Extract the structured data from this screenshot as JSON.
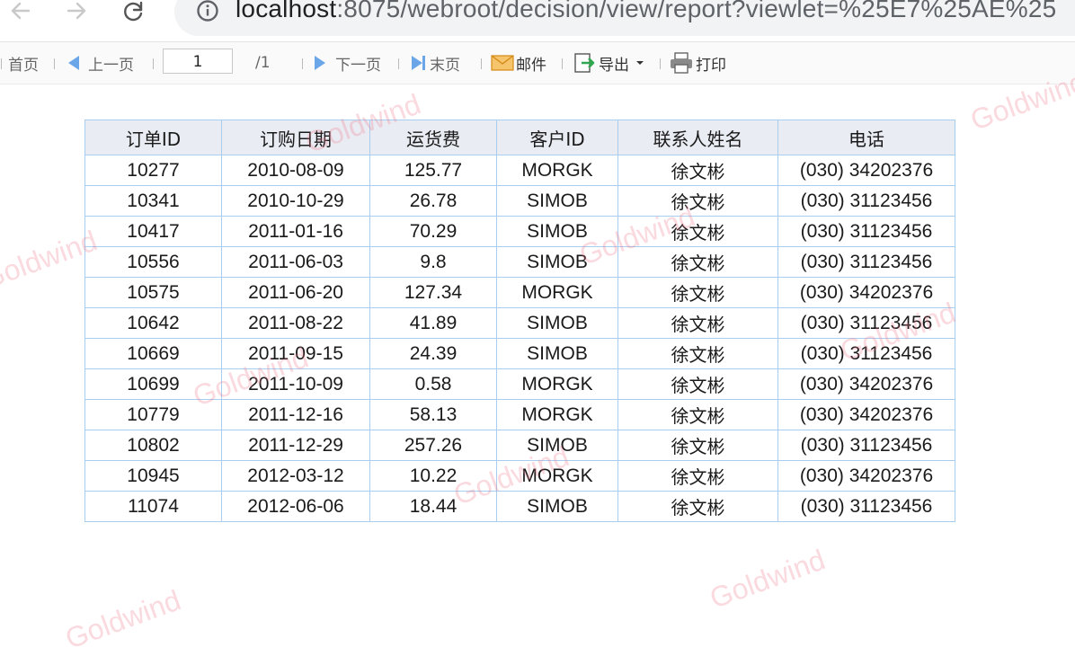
{
  "browser": {
    "url_host": "localhost",
    "url_rest": ":8075/webroot/decision/view/report?viewlet=%25E7%25AE%25"
  },
  "toolbar": {
    "first": "首页",
    "prev": "上一页",
    "page_current": "1",
    "page_total": "/1",
    "next": "下一页",
    "last": "末页",
    "mail": "邮件",
    "export": "导出",
    "print": "打印"
  },
  "table": {
    "headers": [
      "订单ID",
      "订购日期",
      "运货费",
      "客户ID",
      "联系人姓名",
      "电话"
    ],
    "rows": [
      [
        "10277",
        "2010-08-09",
        "125.77",
        "MORGK",
        "徐文彬",
        "(030) 34202376"
      ],
      [
        "10341",
        "2010-10-29",
        "26.78",
        "SIMOB",
        "徐文彬",
        "(030) 31123456"
      ],
      [
        "10417",
        "2011-01-16",
        "70.29",
        "SIMOB",
        "徐文彬",
        "(030) 31123456"
      ],
      [
        "10556",
        "2011-06-03",
        "9.8",
        "SIMOB",
        "徐文彬",
        "(030) 31123456"
      ],
      [
        "10575",
        "2011-06-20",
        "127.34",
        "MORGK",
        "徐文彬",
        "(030) 34202376"
      ],
      [
        "10642",
        "2011-08-22",
        "41.89",
        "SIMOB",
        "徐文彬",
        "(030) 31123456"
      ],
      [
        "10669",
        "2011-09-15",
        "24.39",
        "SIMOB",
        "徐文彬",
        "(030) 31123456"
      ],
      [
        "10699",
        "2011-10-09",
        "0.58",
        "MORGK",
        "徐文彬",
        "(030) 34202376"
      ],
      [
        "10779",
        "2011-12-16",
        "58.13",
        "MORGK",
        "徐文彬",
        "(030) 34202376"
      ],
      [
        "10802",
        "2011-12-29",
        "257.26",
        "SIMOB",
        "徐文彬",
        "(030) 31123456"
      ],
      [
        "10945",
        "2012-03-12",
        "10.22",
        "MORGK",
        "徐文彬",
        "(030) 34202376"
      ],
      [
        "11074",
        "2012-06-06",
        "18.44",
        "SIMOB",
        "徐文彬",
        "(030) 31123456"
      ]
    ]
  },
  "watermark": {
    "text": "Goldwind",
    "color": "#ec788c"
  },
  "colors": {
    "table_border": "#a9cdee",
    "header_bg": "#e9ecf3",
    "toolbar_icon": "#6aa6e8"
  }
}
